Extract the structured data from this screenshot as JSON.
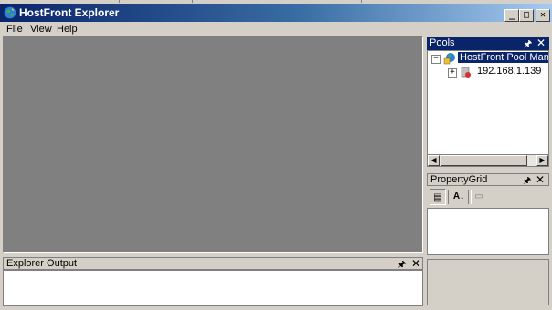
{
  "window": {
    "title": "HostFront Explorer",
    "minimize": "_",
    "maximize": "□",
    "close": "✕"
  },
  "menu": {
    "items": [
      "File",
      "View",
      "Help"
    ]
  },
  "pools": {
    "title": "Pools",
    "pin": "🖈",
    "close": "✕",
    "tree": {
      "root": {
        "label": "HostFront Pool Manag",
        "expander": "−"
      },
      "child": {
        "label": "192.168.1.139",
        "expander": "+"
      }
    },
    "scroll_left": "◀",
    "scroll_right": "▶"
  },
  "property_grid": {
    "title": "PropertyGrid",
    "pin": "🖈",
    "close": "✕",
    "toolbar": {
      "categorized": "▤",
      "alphabetical": "A↓",
      "pages": "▭"
    }
  },
  "output": {
    "title": "Explorer Output",
    "pin": "🖈",
    "close": "✕"
  },
  "colors": {
    "titlebar_start": "#0a246a",
    "titlebar_end": "#a6caf0",
    "workspace": "#808080",
    "chrome": "#d4d0c8"
  }
}
